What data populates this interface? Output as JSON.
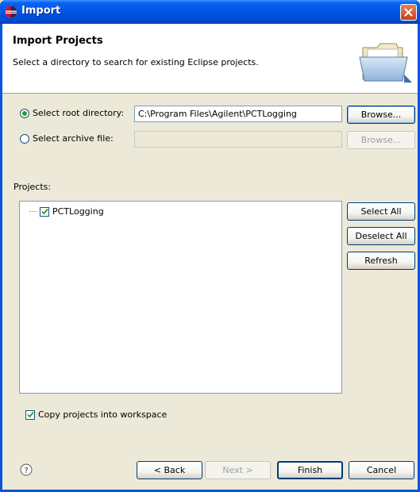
{
  "window": {
    "title": "Import"
  },
  "banner": {
    "title": "Import Projects",
    "description": "Select a directory to search for existing Eclipse projects."
  },
  "source": {
    "root_option": {
      "label": "Select root directory:",
      "selected": true
    },
    "root_path": "C:\\Program Files\\Agilent\\PCTLogging",
    "root_browse": "Browse...",
    "archive_option": {
      "label": "Select archive file:",
      "selected": false
    },
    "archive_path": "",
    "archive_browse": "Browse..."
  },
  "projects": {
    "label": "Projects:",
    "items": [
      {
        "name": "PCTLogging",
        "checked": true
      }
    ],
    "select_all": "Select All",
    "deselect_all": "Deselect All",
    "refresh": "Refresh"
  },
  "copy_option": {
    "label": "Copy projects into workspace",
    "checked": true
  },
  "footer": {
    "back": "< Back",
    "next": "Next >",
    "finish": "Finish",
    "cancel": "Cancel"
  },
  "icons": {
    "app": "eclipse-icon",
    "close": "close-icon",
    "banner": "folder-icon",
    "help": "help-icon"
  },
  "colors": {
    "titlebar": "#0055e5",
    "close": "#c7421a",
    "accent_check": "#21a121"
  }
}
